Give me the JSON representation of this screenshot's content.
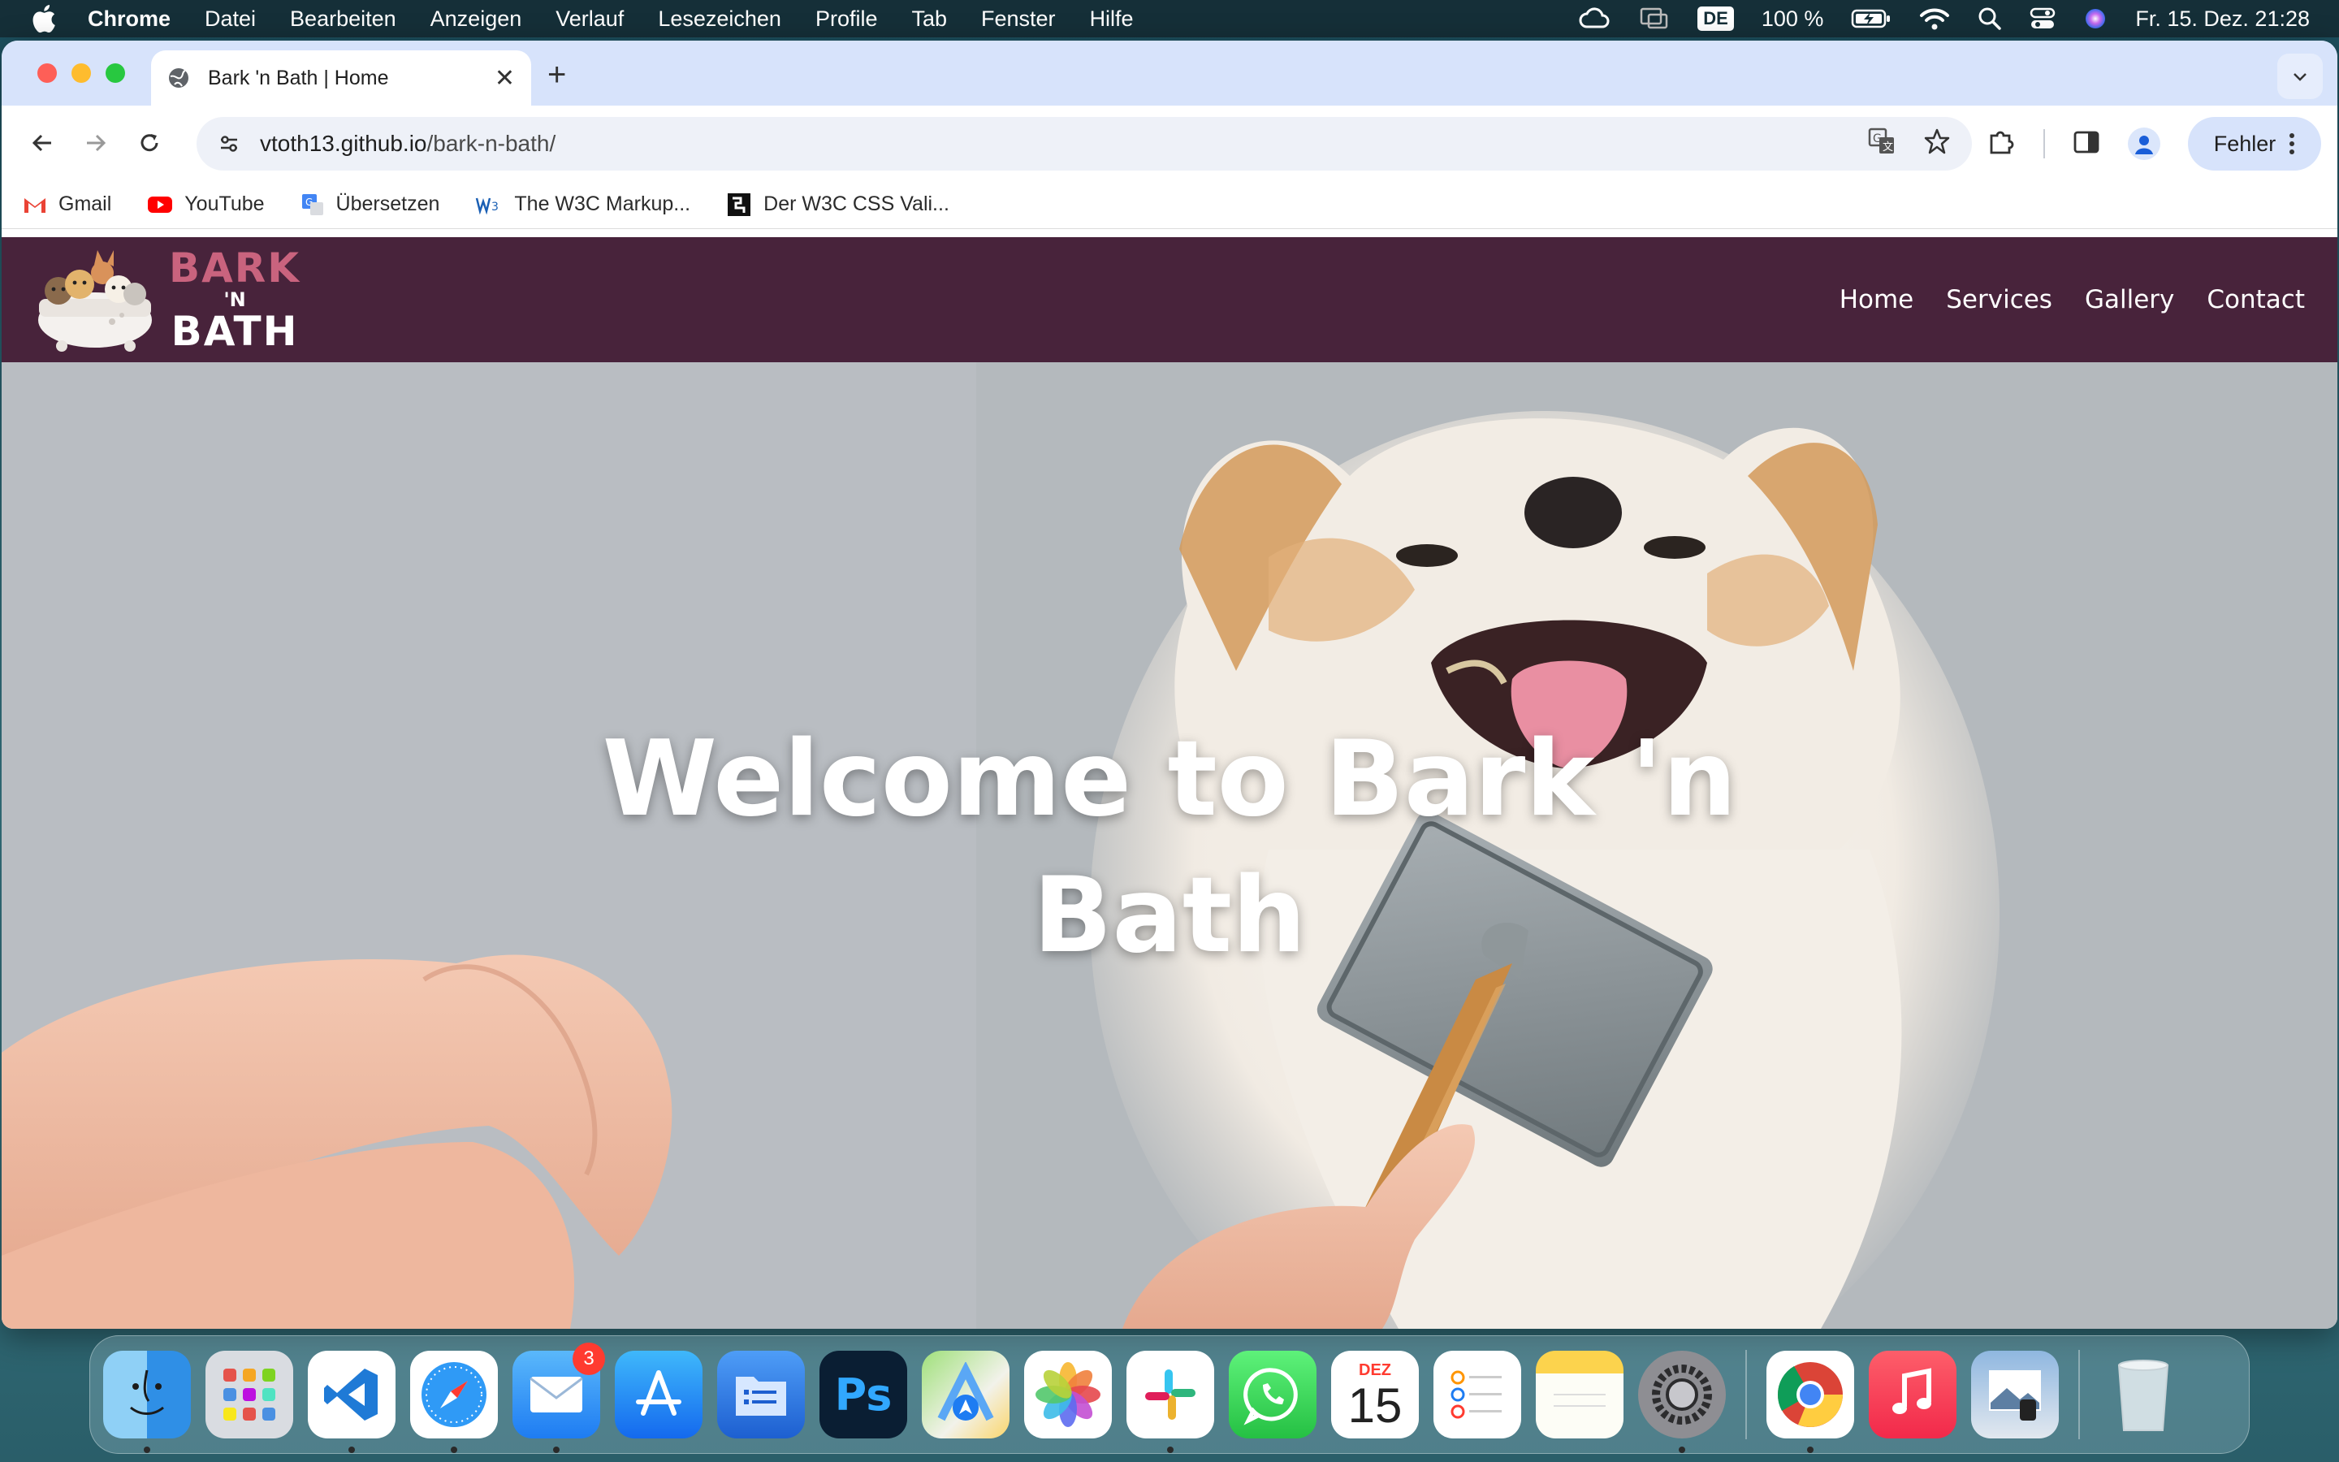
{
  "menubar": {
    "app_name": "Chrome",
    "items": [
      "Datei",
      "Bearbeiten",
      "Anzeigen",
      "Verlauf",
      "Lesezeichen",
      "Profile",
      "Tab",
      "Fenster",
      "Hilfe"
    ],
    "input_source": "DE",
    "battery": "100 %",
    "datetime": "Fr. 15. Dez.  21:28"
  },
  "browser": {
    "tab_title": "Bark 'n Bath | Home",
    "url_host": "vtoth13.github.io",
    "url_path": "/bark-n-bath/",
    "profile_label": "Fehler",
    "bookmarks": [
      "Gmail",
      "YouTube",
      "Übersetzen",
      "The W3C Markup...",
      "Der W3C CSS Vali..."
    ]
  },
  "site": {
    "logo": {
      "line1": "BARK",
      "line2": "'N",
      "line3": "BATH"
    },
    "nav": [
      "Home",
      "Services",
      "Gallery",
      "Contact"
    ],
    "hero": {
      "title_line1": "Welcome to Bark 'n",
      "title_line2": "Bath"
    }
  },
  "dock": {
    "apps": [
      "Finder",
      "Launchpad",
      "Visual Studio Code",
      "Safari",
      "Mail",
      "App Store",
      "Files",
      "Photoshop",
      "Maps",
      "Photos",
      "Slack",
      "WhatsApp",
      "Calendar",
      "Reminders",
      "Notes",
      "System Settings",
      "Chrome",
      "Music",
      "Preview",
      "Trash"
    ],
    "mail_badge": "3",
    "calendar_month": "DEZ",
    "calendar_day": "15",
    "photoshop_label": "Ps"
  }
}
